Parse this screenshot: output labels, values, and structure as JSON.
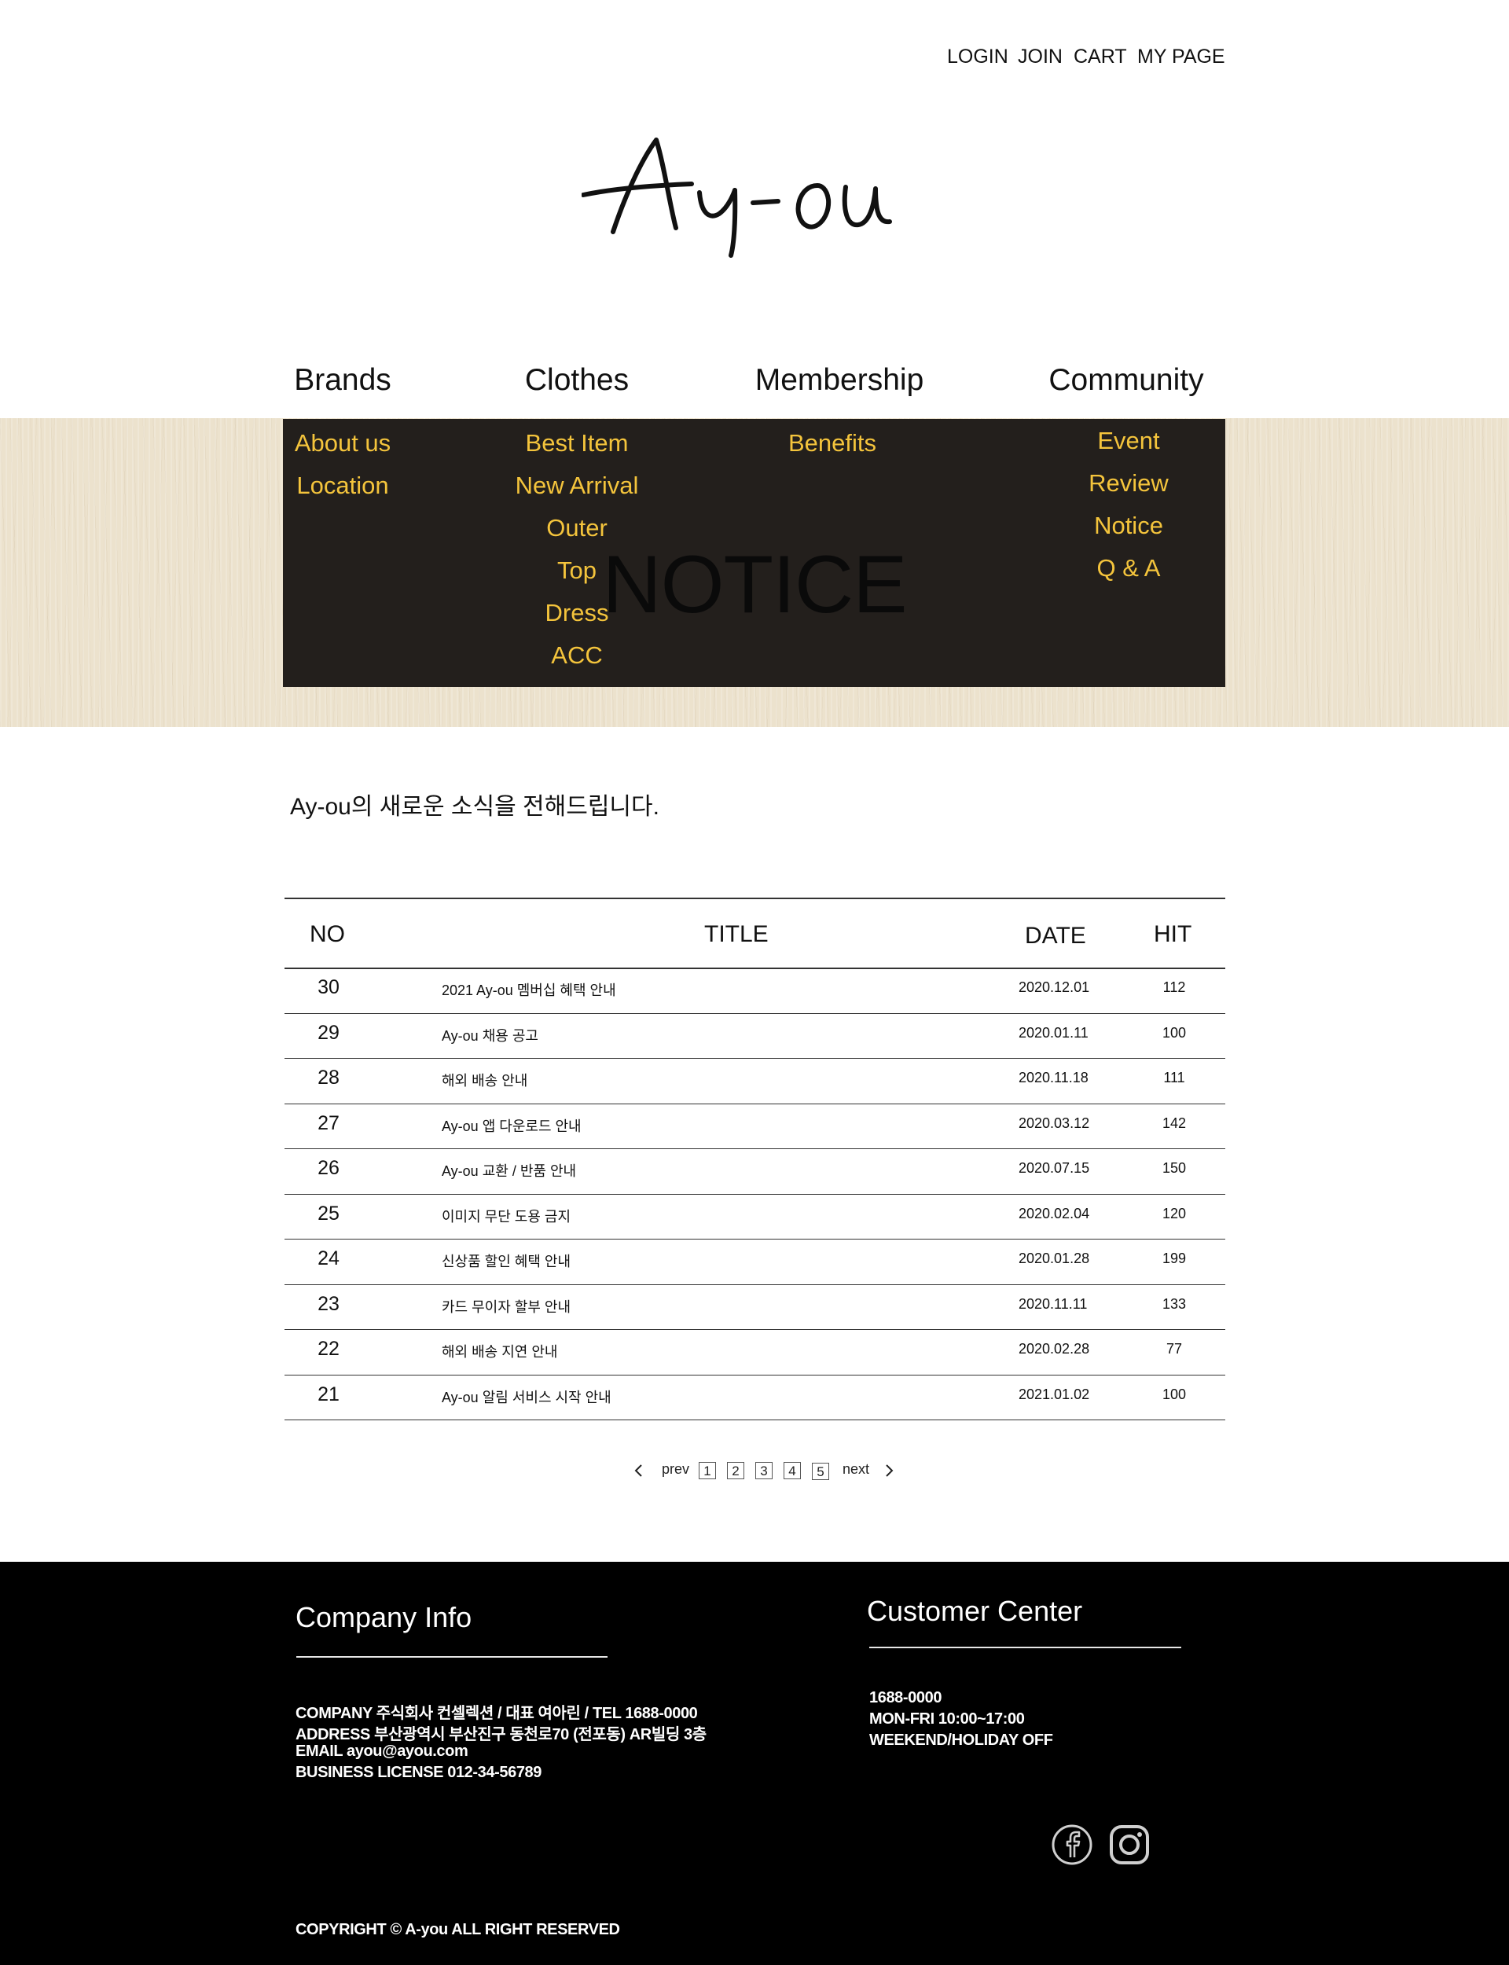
{
  "top_links": [
    "LOGIN",
    "JOIN",
    "CART",
    "MY PAGE"
  ],
  "brand": {
    "logo_text": "Ay-ou"
  },
  "nav": [
    {
      "label": "Brands",
      "items": [
        "About us",
        "Location"
      ]
    },
    {
      "label": "Clothes",
      "items": [
        "Best Item",
        "New Arrival",
        "Outer",
        "Top",
        "Dress",
        "ACC"
      ]
    },
    {
      "label": "Membership",
      "items": [
        "Benefits"
      ]
    },
    {
      "label": "Community",
      "items": [
        "Event",
        "Review",
        "Notice",
        "Q & A"
      ]
    }
  ],
  "page": {
    "title": "NOTICE",
    "intro": "Ay-ou의 새로운 소식을 전해드립니다."
  },
  "table": {
    "headers": {
      "no": "NO",
      "title": "TITLE",
      "date": "DATE",
      "hit": "HIT"
    },
    "rows": [
      {
        "no": "30",
        "title": "2021 Ay-ou 멤버십 혜택 안내",
        "date": "2020.12.01",
        "hit": "112"
      },
      {
        "no": "29",
        "title": "Ay-ou 채용 공고",
        "date": "2020.01.11",
        "hit": "100"
      },
      {
        "no": "28",
        "title": "해외 배송 안내",
        "date": "2020.11.18",
        "hit": "111"
      },
      {
        "no": "27",
        "title": "Ay-ou 앱 다운로드 안내",
        "date": "2020.03.12",
        "hit": "142"
      },
      {
        "no": "26",
        "title": "Ay-ou 교환 / 반품 안내",
        "date": "2020.07.15",
        "hit": "150"
      },
      {
        "no": "25",
        "title": "이미지 무단 도용 금지",
        "date": "2020.02.04",
        "hit": "120"
      },
      {
        "no": "24",
        "title": "신상품 할인 혜택 안내",
        "date": "2020.01.28",
        "hit": "199"
      },
      {
        "no": "23",
        "title": "카드 무이자 할부 안내",
        "date": "2020.11.11",
        "hit": "133"
      },
      {
        "no": "22",
        "title": "해외 배송 지연 안내",
        "date": "2020.02.28",
        "hit": "77"
      },
      {
        "no": "21",
        "title": "Ay-ou 알림 서비스 시작 안내",
        "date": "2021.01.02",
        "hit": "100"
      }
    ]
  },
  "pagination": {
    "prev": "prev",
    "next": "next",
    "pages": [
      "1",
      "2",
      "3",
      "4",
      "5"
    ]
  },
  "footer": {
    "company_heading": "Company Info",
    "company_lines": [
      "COMPANY     주식회사 컨셀렉션 / 대표 여아린 / TEL 1688-0000",
      "ADDRESS     부산광역시 부산진구 동천로70 (전포동) AR빌딩 3층",
      "EMAIL          ayou@ayou.com",
      "BUSINESS LICENSE       012-34-56789"
    ],
    "customer_heading": "Customer Center",
    "customer_lines": [
      "1688-0000",
      "MON-FRI 10:00~17:00",
      "WEEKEND/HOLIDAY OFF"
    ],
    "social_icons": [
      "facebook-icon",
      "instagram-icon"
    ],
    "copyright": "COPYRIGHT © A-you ALL RIGHT RESERVED"
  }
}
